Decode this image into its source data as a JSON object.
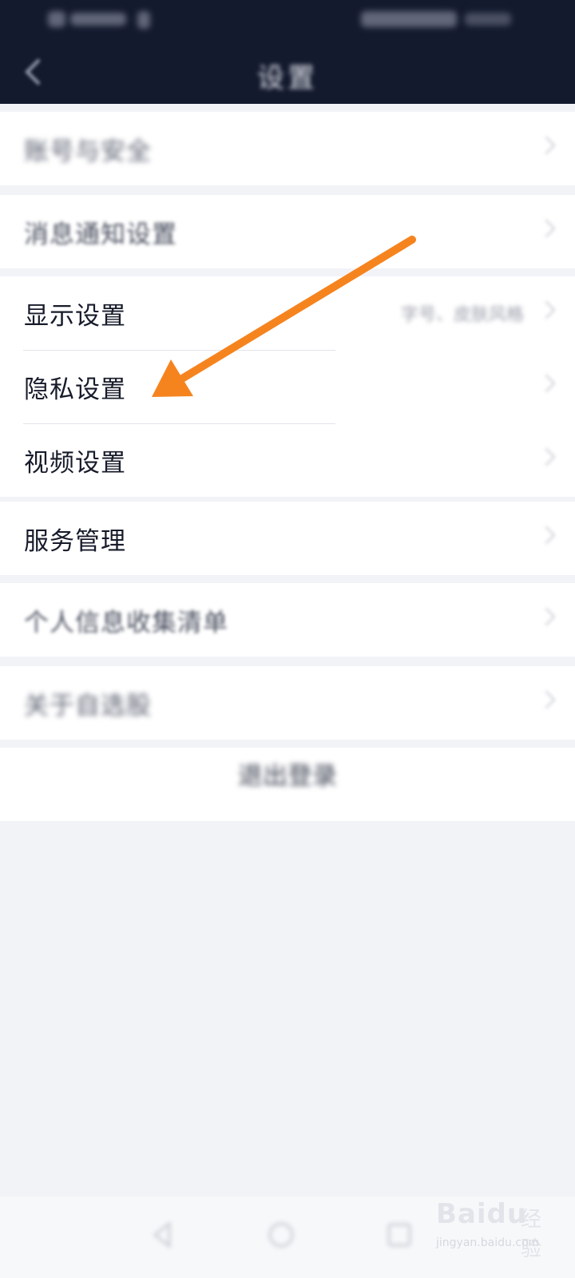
{
  "header": {
    "title": "设置"
  },
  "groups": [
    {
      "items": [
        {
          "label": "账号与安全"
        }
      ]
    },
    {
      "items": [
        {
          "label": "消息通知设置"
        }
      ]
    },
    {
      "items": [
        {
          "label": "显示设置",
          "value": "字号、皮肤风格"
        },
        {
          "label": "隐私设置"
        },
        {
          "label": "视频设置"
        }
      ]
    },
    {
      "items": [
        {
          "label": "服务管理"
        }
      ]
    },
    {
      "items": [
        {
          "label": "个人信息收集清单"
        }
      ]
    },
    {
      "items": [
        {
          "label": "关于自选股"
        }
      ]
    }
  ],
  "logout": {
    "label": "退出登录"
  },
  "watermark": {
    "brand": "Baidu",
    "product": "经验",
    "url": "jingyan.baidu.com"
  },
  "colors": {
    "header_bg": "#141a2e",
    "arrow": "#f5841f",
    "page_bg": "#f2f3f7"
  },
  "icons": {
    "back": "back-arrow-icon",
    "row_chevron": "chevron-right-icon",
    "annotation": "orange-arrow-icon"
  }
}
